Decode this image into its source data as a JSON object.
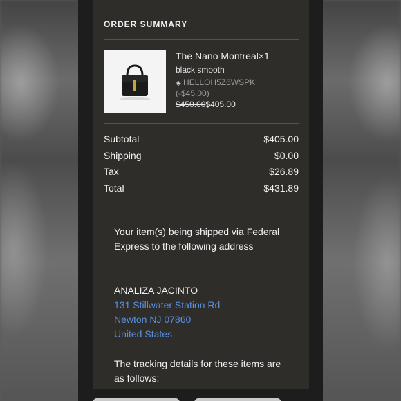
{
  "section_title": "ORDER SUMMARY",
  "product": {
    "name": "The Nano Montreal×1",
    "variant": "black smooth",
    "promo_code": "HELLOH5Z6WSPK",
    "promo_discount": "(-$45.00)",
    "price_old": "$450.00",
    "price_new": "$405.00"
  },
  "totals": [
    {
      "label": "Subtotal",
      "value": "$405.00"
    },
    {
      "label": "Shipping",
      "value": "$0.00"
    },
    {
      "label": "Tax",
      "value": "$26.89"
    },
    {
      "label": "Total",
      "value": "$431.89"
    }
  ],
  "shipping": {
    "intro": "Your item(s) being shipped via Federal Express to the following address",
    "name": "ANALIZA JACINTO",
    "street": "131 Stillwater Station Rd",
    "city": "Newton NJ 07860",
    "country": "United States",
    "tracking_intro": "The tracking details for these items are as follows:"
  },
  "colors": {
    "card_bg": "#2e2d2a",
    "link": "#5b8fe0",
    "muted": "#9a9a9a"
  }
}
